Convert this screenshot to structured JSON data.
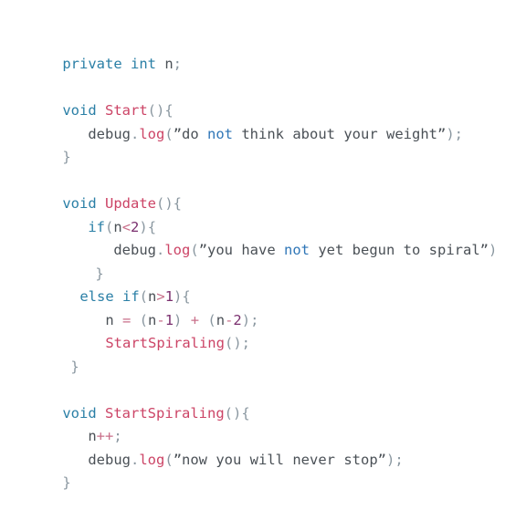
{
  "lines": [
    [
      {
        "t": "private",
        "c": "kw"
      },
      {
        "t": " ",
        "c": "tx"
      },
      {
        "t": "int",
        "c": "kw"
      },
      {
        "t": " n",
        "c": "id"
      },
      {
        "t": ";",
        "c": "pn"
      }
    ],
    [
      {
        "t": "void",
        "c": "kw"
      },
      {
        "t": " ",
        "c": "tx"
      },
      {
        "t": "Start",
        "c": "fn"
      },
      {
        "t": "(){",
        "c": "pn"
      }
    ],
    [
      {
        "t": "debug",
        "c": "id"
      },
      {
        "t": ".",
        "c": "pn"
      },
      {
        "t": "log",
        "c": "fn"
      },
      {
        "t": "(",
        "c": "pn"
      },
      {
        "t": "”do ",
        "c": "tx"
      },
      {
        "t": "not",
        "c": "nt"
      },
      {
        "t": " think about your weight”",
        "c": "tx"
      },
      {
        "t": ");",
        "c": "pn"
      }
    ],
    [
      {
        "t": "}",
        "c": "pn"
      }
    ],
    [
      {
        "t": "void",
        "c": "kw"
      },
      {
        "t": " ",
        "c": "tx"
      },
      {
        "t": "Update",
        "c": "fn"
      },
      {
        "t": "(){",
        "c": "pn"
      }
    ],
    [
      {
        "t": "if",
        "c": "kw"
      },
      {
        "t": "(",
        "c": "pn"
      },
      {
        "t": "n",
        "c": "id"
      },
      {
        "t": "<",
        "c": "op"
      },
      {
        "t": "2",
        "c": "nm"
      },
      {
        "t": "){",
        "c": "pn"
      }
    ],
    [
      {
        "t": "debug",
        "c": "id"
      },
      {
        "t": ".",
        "c": "pn"
      },
      {
        "t": "log",
        "c": "fn"
      },
      {
        "t": "(",
        "c": "pn"
      },
      {
        "t": "”you have ",
        "c": "tx"
      },
      {
        "t": "not",
        "c": "nt"
      },
      {
        "t": " yet begun to spiral”",
        "c": "tx"
      },
      {
        "t": ")",
        "c": "pn"
      }
    ],
    [
      {
        "t": "}",
        "c": "pn"
      }
    ],
    [
      {
        "t": "else",
        "c": "kw"
      },
      {
        "t": " ",
        "c": "tx"
      },
      {
        "t": "if",
        "c": "kw"
      },
      {
        "t": "(",
        "c": "pn"
      },
      {
        "t": "n",
        "c": "id"
      },
      {
        "t": ">",
        "c": "op"
      },
      {
        "t": "1",
        "c": "nm"
      },
      {
        "t": "){",
        "c": "pn"
      }
    ],
    [
      {
        "t": "n",
        "c": "id"
      },
      {
        "t": " = ",
        "c": "op"
      },
      {
        "t": "(",
        "c": "pn"
      },
      {
        "t": "n",
        "c": "id"
      },
      {
        "t": "-",
        "c": "op"
      },
      {
        "t": "1",
        "c": "nm"
      },
      {
        "t": ")",
        "c": "pn"
      },
      {
        "t": " + ",
        "c": "op"
      },
      {
        "t": "(",
        "c": "pn"
      },
      {
        "t": "n",
        "c": "id"
      },
      {
        "t": "-",
        "c": "op"
      },
      {
        "t": "2",
        "c": "nm"
      },
      {
        "t": ");",
        "c": "pn"
      }
    ],
    [
      {
        "t": "StartSpiraling",
        "c": "fn"
      },
      {
        "t": "();",
        "c": "pn"
      }
    ],
    [
      {
        "t": "}",
        "c": "pn"
      }
    ],
    [
      {
        "t": "void",
        "c": "kw"
      },
      {
        "t": " ",
        "c": "tx"
      },
      {
        "t": "StartSpiraling",
        "c": "fn"
      },
      {
        "t": "(){",
        "c": "pn"
      }
    ],
    [
      {
        "t": "n",
        "c": "id"
      },
      {
        "t": "++",
        "c": "op"
      },
      {
        "t": ";",
        "c": "pn"
      }
    ],
    [
      {
        "t": "debug",
        "c": "id"
      },
      {
        "t": ".",
        "c": "pn"
      },
      {
        "t": "log",
        "c": "fn"
      },
      {
        "t": "(",
        "c": "pn"
      },
      {
        "t": "”now you will never stop”",
        "c": "tx"
      },
      {
        "t": ");",
        "c": "pn"
      }
    ],
    [
      {
        "t": "}",
        "c": "pn"
      }
    ]
  ]
}
